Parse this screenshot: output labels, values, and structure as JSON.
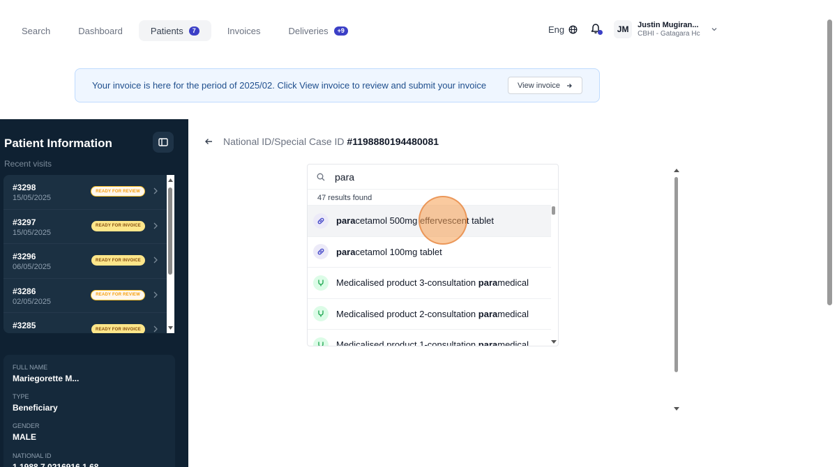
{
  "nav": {
    "items": [
      {
        "label": "Search",
        "badge": ""
      },
      {
        "label": "Dashboard",
        "badge": ""
      },
      {
        "label": "Patients",
        "badge": "7"
      },
      {
        "label": "Invoices",
        "badge": ""
      },
      {
        "label": "Deliveries",
        "badge": "+9"
      }
    ],
    "active": "Patients"
  },
  "topbar": {
    "language": "Eng",
    "user_initials": "JM",
    "user_name": "Justin Mugiran...",
    "user_org": "CBHI - Gatagara Hc"
  },
  "banner": {
    "text": "Your invoice is here for the period of 2025/02. Click View invoice to review and submit your invoice",
    "button_label": "View invoice"
  },
  "sidebar": {
    "title": "Patient Information",
    "subtitle": "Recent visits",
    "visits": [
      {
        "id": "#3298",
        "date": "15/05/2025",
        "status": "READY FOR REVIEW",
        "kind": "review"
      },
      {
        "id": "#3297",
        "date": "15/05/2025",
        "status": "READY FOR INVOICE",
        "kind": "invoice"
      },
      {
        "id": "#3296",
        "date": "06/05/2025",
        "status": "READY FOR INVOICE",
        "kind": "invoice"
      },
      {
        "id": "#3286",
        "date": "02/05/2025",
        "status": "READY FOR REVIEW",
        "kind": "review"
      },
      {
        "id": "#3285",
        "date": "",
        "status": "READY FOR INVOICE",
        "kind": "invoice"
      }
    ],
    "info": {
      "full_name_label": "FULL NAME",
      "full_name": "Mariegorette M...",
      "type_label": "TYPE",
      "type": "Beneficiary",
      "gender_label": "GENDER",
      "gender": "MALE",
      "national_id_label": "NATIONAL ID",
      "national_id": "1 1988 7 0216916 1 68"
    }
  },
  "main": {
    "heading_prefix": "National ID/Special Case ID ",
    "heading_id": "#1198880194480081"
  },
  "search": {
    "query": "para",
    "results_count": "47 results found",
    "results": [
      {
        "pre": "",
        "match": "para",
        "post": "cetamol 500mg effervescent tablet",
        "icon": "pill-icon"
      },
      {
        "pre": "",
        "match": "para",
        "post": "cetamol 100mg tablet",
        "icon": "pill-icon"
      },
      {
        "pre": "Medicalised product 3-consultation ",
        "match": "para",
        "post": "medical",
        "icon": "stethoscope-icon"
      },
      {
        "pre": "Medicalised product 2-consultation ",
        "match": "para",
        "post": "medical",
        "icon": "stethoscope-icon"
      },
      {
        "pre": "Medicalised product 1-consultation ",
        "match": "para",
        "post": "medical",
        "icon": "stethoscope-icon"
      }
    ]
  },
  "colors": {
    "accent": "#3b3fc6",
    "sidebar_bg": "#0f2132",
    "banner_bg": "#eff6ff"
  }
}
